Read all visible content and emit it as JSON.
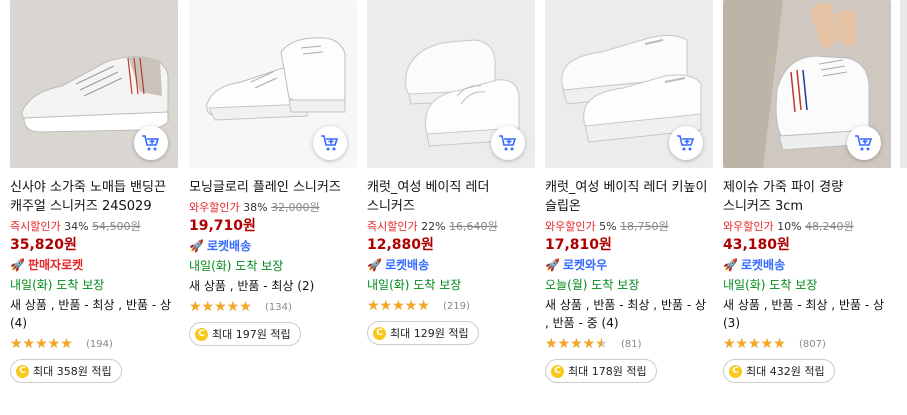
{
  "products": [
    {
      "name": "신사야 소가죽 노매듭 밴딩끈 캐주얼 스니커즈 24S029",
      "discount_label": "즉시할인가",
      "discount_pct": "34%",
      "original_price": "54,500원",
      "price": "35,820원",
      "badge": "판매자로켓",
      "badge_type": "seller",
      "delivery": "내일(화) 도착 보장",
      "condition": "새 상품 , 반품 - 최상 , 반품 - 상 (4)",
      "rating": 4.5,
      "review_count": "(194)",
      "reward": "최대 358원 적립",
      "bg": "#d9d6d2"
    },
    {
      "name": "모닝글로리 플레인 스니커즈",
      "discount_label": "와우할인가",
      "discount_pct": "38%",
      "original_price": "32,000원",
      "price": "19,710원",
      "badge": "로켓배송",
      "badge_type": "rocket",
      "delivery": "내일(화) 도착 보장",
      "condition": "새 상품 , 반품 - 최상 (2)",
      "rating": 5,
      "review_count": "(134)",
      "reward": "최대 197원 적립",
      "bg": "#f7f7f7"
    },
    {
      "name": "캐럿_여성 베이직 레더 스니커즈",
      "discount_label": "즉시할인가",
      "discount_pct": "22%",
      "original_price": "16,640원",
      "price": "12,880원",
      "badge": "로켓배송",
      "badge_type": "rocket",
      "delivery": "내일(화) 도착 보장",
      "condition": "",
      "rating": 4.5,
      "review_count": "(219)",
      "reward": "최대 129원 적립",
      "bg": "#ececec"
    },
    {
      "name": "캐럿_여성 베이직 레더 키높이 슬립온",
      "discount_label": "와우할인가",
      "discount_pct": "5%",
      "original_price": "18,750원",
      "price": "17,810원",
      "badge": "로켓와우",
      "badge_type": "rocket",
      "delivery": "오늘(월) 도착 보장",
      "condition": "새 상품 , 반품 - 최상 , 반품 - 상 , 반품 - 중 (4)",
      "rating": 4,
      "review_count": "(81)",
      "reward": "최대 178원 적립",
      "bg": "#ececec"
    },
    {
      "name": "제이슈 가죽 파이 경량 스니커즈 3cm",
      "discount_label": "와우할인가",
      "discount_pct": "10%",
      "original_price": "48,240원",
      "price": "43,180원",
      "badge": "로켓배송",
      "badge_type": "rocket",
      "delivery": "내일(화) 도착 보장",
      "condition": "새 상품 , 반품 - 최상 , 반품 - 상 (3)",
      "rating": 4.5,
      "review_count": "(807)",
      "reward": "최대 432원 적립",
      "bg": "#cfc8c0"
    }
  ]
}
